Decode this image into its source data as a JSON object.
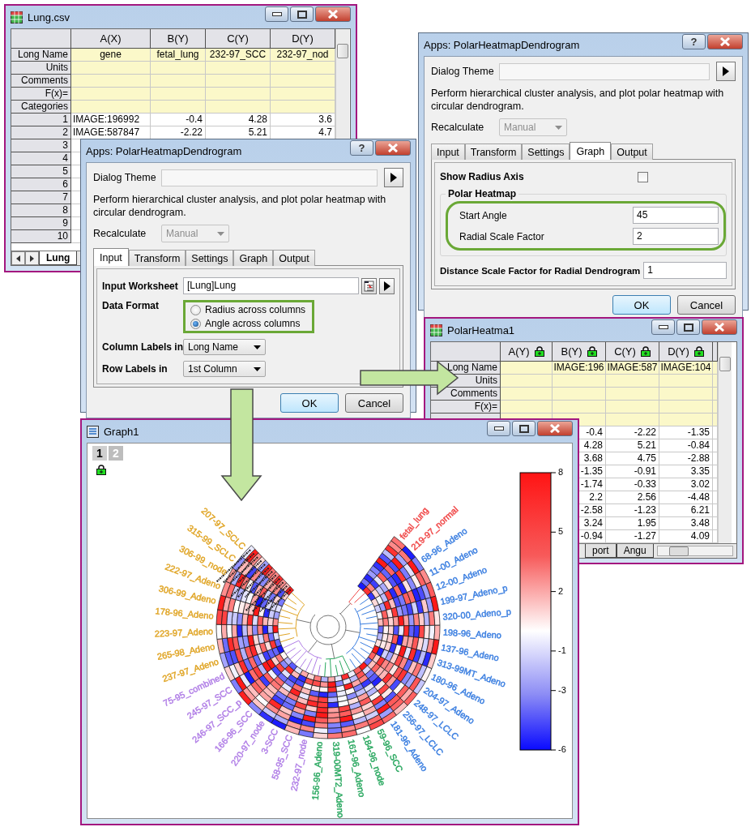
{
  "lung_window": {
    "title": "Lung.csv",
    "columns": [
      "A(X)",
      "B(Y)",
      "C(Y)",
      "D(Y)"
    ],
    "label_rows": [
      {
        "label": "Long Name",
        "cells": [
          "gene",
          "fetal_lung",
          "232-97_SCC",
          "232-97_nod"
        ]
      },
      {
        "label": "Units"
      },
      {
        "label": "Comments"
      },
      {
        "label": "F(x)="
      },
      {
        "label": "Categories"
      }
    ],
    "rows": [
      {
        "number": "1",
        "cells": [
          "IMAGE:196992",
          "-0.4",
          "4.28",
          "3.6"
        ]
      },
      {
        "number": "2",
        "cells": [
          "IMAGE:587847",
          "-2.22",
          "5.21",
          "4.7"
        ]
      },
      {
        "number": "3"
      },
      {
        "number": "4"
      },
      {
        "number": "5"
      },
      {
        "number": "6"
      },
      {
        "number": "7"
      },
      {
        "number": "8"
      },
      {
        "number": "9"
      },
      {
        "number": "10"
      }
    ],
    "sheet_tabs": [
      {
        "label": "Lung",
        "selected": true
      }
    ]
  },
  "dialog_graph": {
    "title": "Apps: PolarHeatmapDendrogram",
    "help": "?",
    "theme_label": "Dialog Theme",
    "description": "Perform hierarchical cluster analysis, and plot polar heatmap with circular dendrogram.",
    "recalculate": {
      "label": "Recalculate",
      "value": "Manual",
      "disabled": true
    },
    "tabs": [
      {
        "label": "Input",
        "selected": false
      },
      {
        "label": "Transform",
        "selected": false
      },
      {
        "label": "Settings",
        "selected": false
      },
      {
        "label": "Graph",
        "selected": true
      },
      {
        "label": "Output",
        "selected": false
      }
    ],
    "show_radius_axis": {
      "label": "Show Radius Axis",
      "checked": false
    },
    "group": {
      "title": "Polar Heatmap",
      "fields": [
        {
          "label": "Start Angle",
          "value": "45"
        },
        {
          "label": "Radial Scale Factor",
          "value": "2"
        }
      ]
    },
    "distance_field": {
      "label": "Distance Scale Factor for Radial Dendrogram",
      "value": "1"
    },
    "buttons": [
      {
        "label": "OK",
        "default": true
      },
      {
        "label": "Cancel",
        "default": false
      }
    ]
  },
  "dialog_input": {
    "title": "Apps: PolarHeatmapDendrogram",
    "help": "?",
    "theme_label": "Dialog Theme",
    "description": "Perform hierarchical cluster analysis, and plot polar heatmap with circular dendrogram.",
    "recalculate": {
      "label": "Recalculate",
      "value": "Manual",
      "disabled": true
    },
    "tabs": [
      {
        "label": "Input",
        "selected": true
      },
      {
        "label": "Transform",
        "selected": false
      },
      {
        "label": "Settings",
        "selected": false
      },
      {
        "label": "Graph",
        "selected": false
      },
      {
        "label": "Output",
        "selected": false
      }
    ],
    "input_worksheet": {
      "label": "Input Worksheet",
      "value": "[Lung]Lung"
    },
    "data_format": {
      "label": "Data Format",
      "options": [
        {
          "label": "Radius across columns",
          "selected": false
        },
        {
          "label": "Angle across columns",
          "selected": true
        }
      ]
    },
    "column_labels": {
      "label": "Column Labels in",
      "value": "Long Name"
    },
    "row_labels": {
      "label": "Row Labels in",
      "value": "1st Column"
    },
    "buttons": [
      {
        "label": "OK",
        "default": true
      },
      {
        "label": "Cancel",
        "default": false
      }
    ]
  },
  "result_window": {
    "title": "PolarHeatma1",
    "columns": [
      "A(Y)",
      "B(Y)",
      "C(Y)",
      "D(Y)"
    ],
    "label_rows": [
      {
        "label": "Long Name",
        "cells": [
          null,
          "IMAGE:196",
          "IMAGE:587",
          "IMAGE:104"
        ]
      },
      {
        "label": "Units"
      },
      {
        "label": "Comments"
      },
      {
        "label": "F(x)="
      }
    ],
    "rows": [
      {
        "cells": [
          null,
          "-0.4",
          "-2.22",
          "-1.35"
        ]
      },
      {
        "cells": [
          null,
          "4.28",
          "5.21",
          "-0.84"
        ]
      },
      {
        "cells": [
          null,
          "3.68",
          "4.75",
          "-2.88"
        ]
      },
      {
        "cells": [
          null,
          "-1.35",
          "-0.91",
          "3.35"
        ]
      },
      {
        "cells": [
          null,
          "-1.74",
          "-0.33",
          "3.02"
        ]
      },
      {
        "cells": [
          null,
          "2.2",
          "2.56",
          "-4.48"
        ]
      },
      {
        "cells": [
          null,
          "-2.58",
          "-1.23",
          "6.21"
        ]
      },
      {
        "cells": [
          null,
          "3.24",
          "1.95",
          "3.48"
        ]
      },
      {
        "cells": [
          null,
          "-0.94",
          "-1.27",
          "4.09"
        ]
      }
    ],
    "sheet_tabs": [
      {
        "label": "port",
        "selected": false
      },
      {
        "label": "Angu",
        "selected": false
      }
    ]
  },
  "graph_window": {
    "title": "Graph1",
    "layers": [
      {
        "label": "1",
        "selected": true
      },
      {
        "label": "2",
        "selected": false
      }
    ],
    "chart": {
      "samples": [
        {
          "label": "fetal_lung",
          "color": "#f04848"
        },
        {
          "label": "219-97_normal",
          "color": "#f04848"
        },
        {
          "label": "68-96_Adeno",
          "color": "#3a7ee0"
        },
        {
          "label": "11-00_Adeno",
          "color": "#3a7ee0"
        },
        {
          "label": "12-00_Adeno",
          "color": "#3a7ee0"
        },
        {
          "label": "199-97_Adeno_p",
          "color": "#3a7ee0"
        },
        {
          "label": "320-00_Adeno_p",
          "color": "#3a7ee0"
        },
        {
          "label": "198-96_Adeno",
          "color": "#3a7ee0"
        },
        {
          "label": "137-96_Adeno",
          "color": "#3a7ee0"
        },
        {
          "label": "313-99MT_Adeno",
          "color": "#3a7ee0"
        },
        {
          "label": "180-96_Adeno",
          "color": "#3a7ee0"
        },
        {
          "label": "204-97_Adeno",
          "color": "#3a7ee0"
        },
        {
          "label": "248-97_LCLC",
          "color": "#3a7ee0"
        },
        {
          "label": "256-97_LCLC",
          "color": "#3a7ee0"
        },
        {
          "label": "181-96_Adeno",
          "color": "#3a7ee0"
        },
        {
          "label": "59-96_SCC",
          "color": "#2aa860"
        },
        {
          "label": "184-96_node",
          "color": "#2aa860"
        },
        {
          "label": "161-96_Adeno",
          "color": "#2aa860"
        },
        {
          "label": "319-00MT2_Adeno",
          "color": "#2aa860"
        },
        {
          "label": "156-96_Adeno",
          "color": "#2aa860"
        },
        {
          "label": "232-97_node",
          "color": "#b07ee6"
        },
        {
          "label": "58-95_SCC",
          "color": "#b07ee6"
        },
        {
          "label": "3-SCC",
          "color": "#b07ee6"
        },
        {
          "label": "220-97_node",
          "color": "#b07ee6"
        },
        {
          "label": "166-96_SCC",
          "color": "#b07ee6"
        },
        {
          "label": "246-97_SCC_p",
          "color": "#b07ee6"
        },
        {
          "label": "245-97_SCC",
          "color": "#b07ee6"
        },
        {
          "label": "75-95_combined",
          "color": "#b07ee6"
        },
        {
          "label": "237-97_Adeno",
          "color": "#e0a526"
        },
        {
          "label": "265-98_Adeno",
          "color": "#e0a526"
        },
        {
          "label": "223-97_Adeno",
          "color": "#e0a526"
        },
        {
          "label": "178-96_Adeno",
          "color": "#e0a526"
        },
        {
          "label": "306-99_Adeno",
          "color": "#e0a526"
        },
        {
          "label": "222-97_Adeno",
          "color": "#e0a526"
        },
        {
          "label": "306-99_node",
          "color": "#e0a526"
        },
        {
          "label": "315-99_SCLC",
          "color": "#e0a526"
        },
        {
          "label": "207-97_SCLC",
          "color": "#e0a526"
        }
      ],
      "colorbar": {
        "ticks": [
          "8",
          "5",
          "2",
          "-1",
          "-3",
          "-6"
        ]
      }
    }
  }
}
